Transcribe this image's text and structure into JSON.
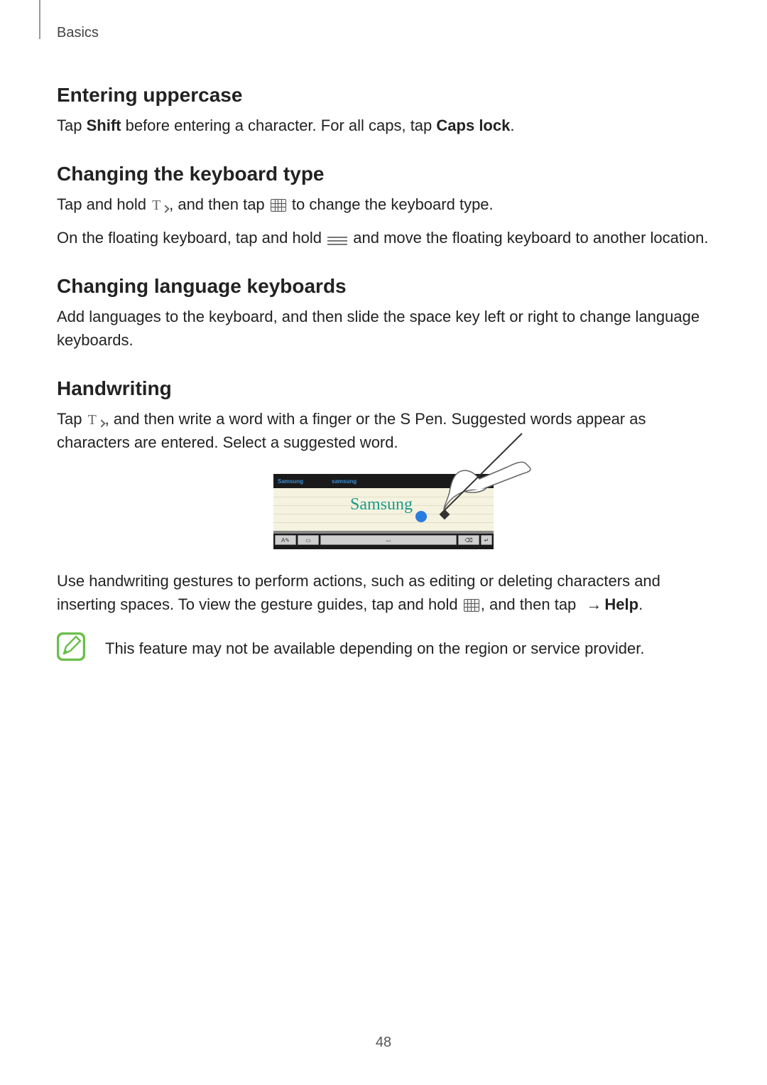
{
  "section_tag": "Basics",
  "page_number": "48",
  "sections": {
    "uppercase": {
      "heading": "Entering uppercase",
      "p1_a": "Tap ",
      "p1_shift": "Shift",
      "p1_b": " before entering a character. For all caps, tap ",
      "p1_caps": "Caps lock",
      "p1_c": "."
    },
    "kbtype": {
      "heading": "Changing the keyboard type",
      "p1_a": "Tap and hold ",
      "p1_b": ", and then tap ",
      "p1_c": " to change the keyboard type.",
      "p2_a": "On the floating keyboard, tap and hold ",
      "p2_b": " and move the floating keyboard to another location."
    },
    "lang": {
      "heading": "Changing language keyboards",
      "p1": "Add languages to the keyboard, and then slide the space key left or right to change language keyboards."
    },
    "handwriting": {
      "heading": "Handwriting",
      "p1_a": "Tap ",
      "p1_b": ", and then write a word with a finger or the S Pen. Suggested words appear as characters are entered. Select a suggested word.",
      "p2_a": "Use handwriting gestures to perform actions, such as editing or deleting characters and inserting spaces. To view the gesture guides, tap and hold ",
      "p2_b": ", and then tap ",
      "p2_arrow": "→",
      "p2_help": "Help",
      "p2_c": "."
    },
    "note": "This feature may not be available depending on the region or service provider."
  },
  "figure": {
    "suggestions": [
      "Samsung",
      "samsung"
    ],
    "handwritten": "Samsung"
  }
}
